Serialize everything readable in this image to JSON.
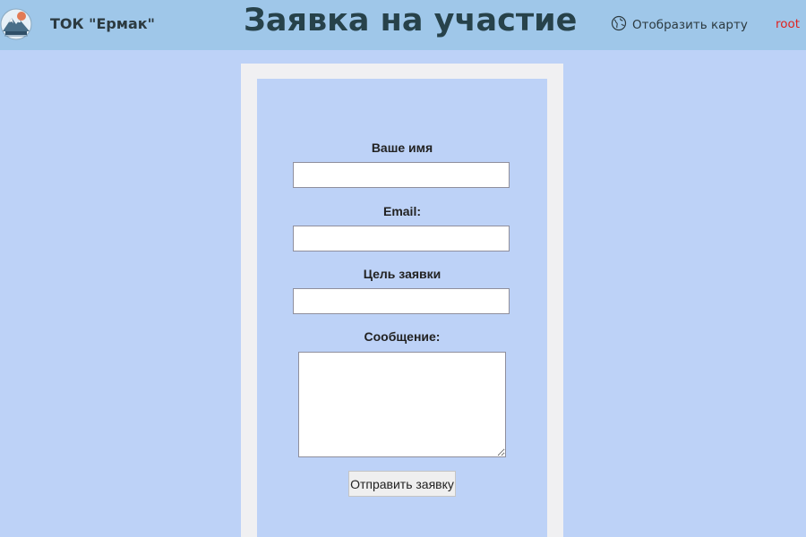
{
  "header": {
    "brand": "ТОК \"Ермак\"",
    "title": "Заявка на участие",
    "map_link": "Отобразить карту",
    "user": "root",
    "logo_icon": "mountain-logo-icon",
    "map_icon": "globe-icon"
  },
  "form": {
    "name_label": "Ваше имя",
    "name_value": "",
    "email_label": "Email:",
    "email_value": "",
    "purpose_label": "Цель заявки",
    "purpose_value": "",
    "message_label": "Сообщение:",
    "message_value": "",
    "submit_label": "Отправить заявку"
  },
  "colors": {
    "background": "#bdd2f7",
    "header": "#9fc7e9",
    "title": "#27424a",
    "user": "#e0231f"
  }
}
